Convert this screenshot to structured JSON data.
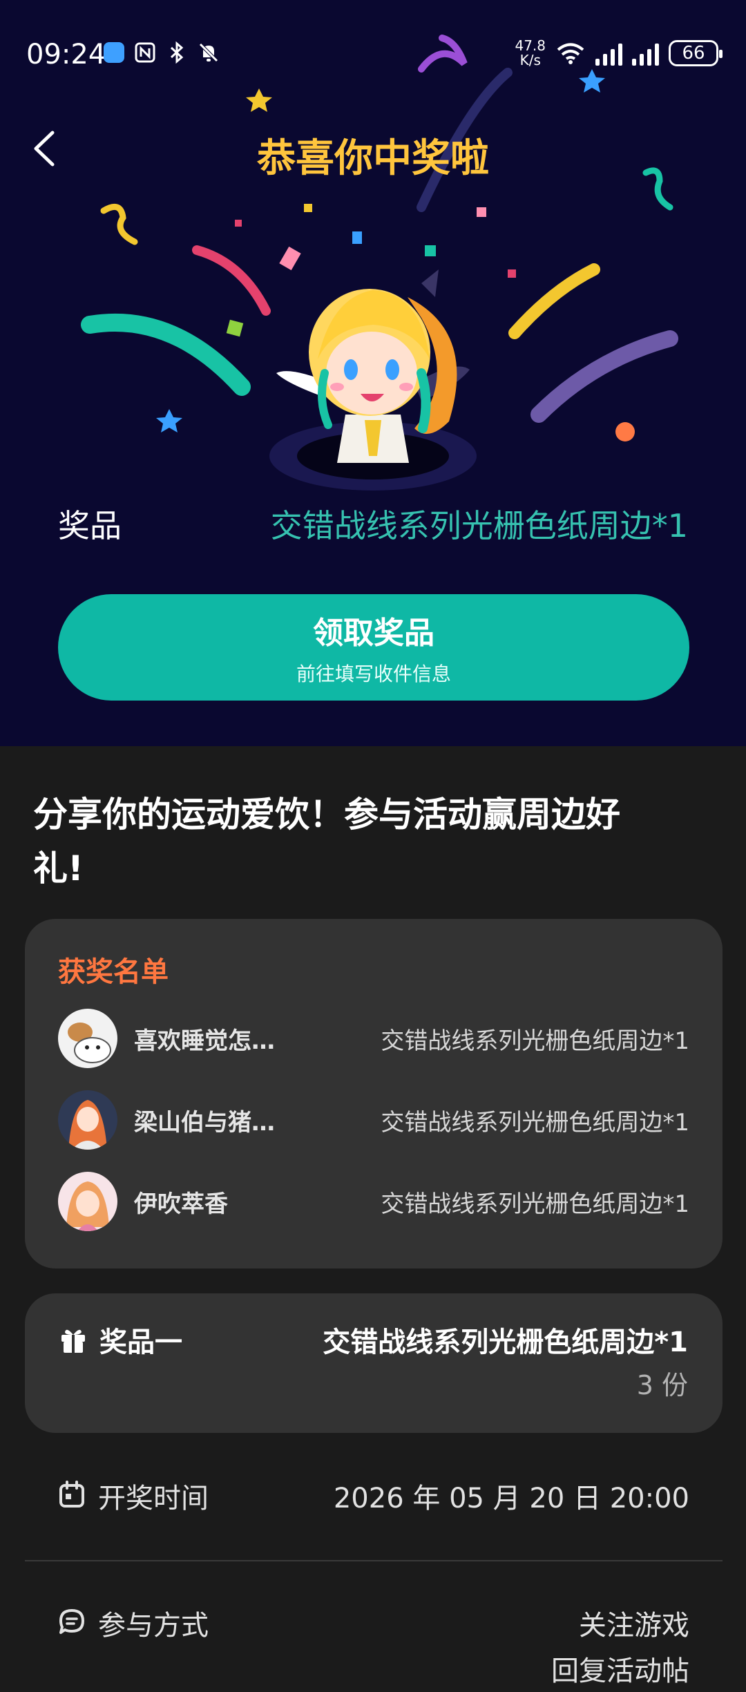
{
  "status_bar": {
    "time": "09:24",
    "speed_value": "47.8",
    "speed_unit": "K/s",
    "battery": "66"
  },
  "header": {
    "title": "恭喜你中奖啦"
  },
  "prize": {
    "label": "奖品",
    "value": "交错战线系列光栅色纸周边*1"
  },
  "claim_button": {
    "main": "领取奖品",
    "sub": "前往填写收件信息"
  },
  "activity": {
    "heading_line1": "分享你的运动爱饮！参与活动赢周边好",
    "heading_line2": "礼!"
  },
  "winners": {
    "title": "获奖名单",
    "rows": [
      {
        "name": "喜欢睡觉怎…",
        "prize": "交错战线系列光栅色纸周边*1"
      },
      {
        "name": "梁山伯与猪…",
        "prize": "交错战线系列光栅色纸周边*1"
      },
      {
        "name": "伊吹萃香",
        "prize": "交错战线系列光栅色纸周边*1"
      }
    ]
  },
  "prize_card": {
    "label": "奖品一",
    "value": "交错战线系列光栅色纸周边*1",
    "count": "3 份"
  },
  "draw_time": {
    "label": "开奖时间",
    "value": "2026 年 05 月 20 日 20:00"
  },
  "participate": {
    "label": "参与方式",
    "value_line1": "关注游戏",
    "value_line2": "回复活动帖"
  },
  "colors": {
    "hero_bg": "#0a0830",
    "accent_teal": "#0fb8a5",
    "title_yellow": "#ffc53d",
    "winners_orange": "#ff7740"
  }
}
